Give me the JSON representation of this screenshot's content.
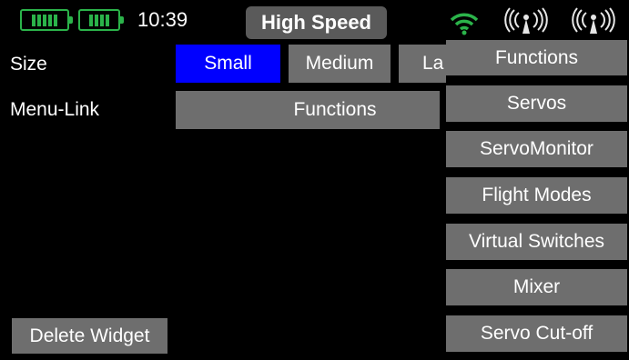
{
  "status_bar": {
    "time": "10:39",
    "mode": "High Speed",
    "batteries": [
      "tx-battery",
      "rx-battery"
    ],
    "icons": [
      "wifi-icon",
      "antenna-icon",
      "antenna-icon"
    ],
    "accent_color": "#2bb34a"
  },
  "settings": {
    "size_label": "Size",
    "size_options": [
      "Small",
      "Medium",
      "La"
    ],
    "size_selected": "Small",
    "menu_link_label": "Menu-Link",
    "menu_link_value": "Functions"
  },
  "menu": {
    "items": [
      "Functions",
      "Servos",
      "ServoMonitor",
      "Flight Modes",
      "Virtual Switches",
      "Mixer",
      "Servo Cut-off"
    ]
  },
  "footer": {
    "delete_label": "Delete Widget"
  },
  "colors": {
    "background": "#000000",
    "button": "#6e6e6e",
    "selected": "#0000ff"
  }
}
